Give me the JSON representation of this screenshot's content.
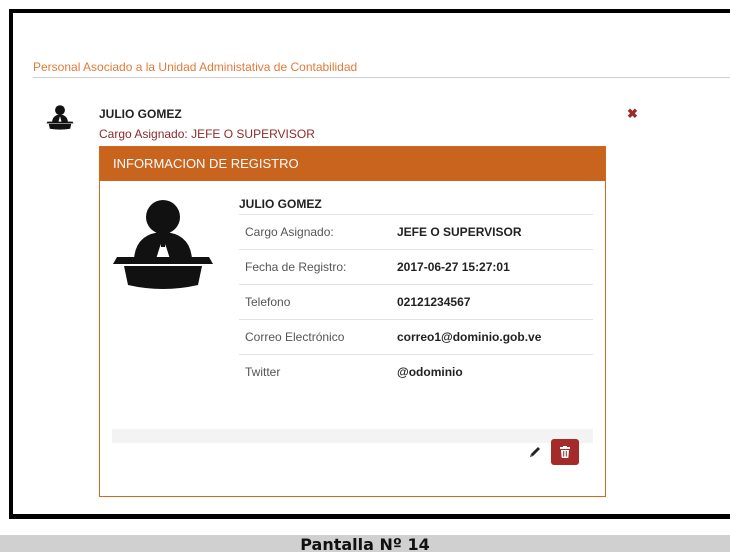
{
  "section": {
    "title": "Personal Asociado a la Unidad Administativa de Contabilidad"
  },
  "person": {
    "name": "JULIO GOMEZ",
    "role_line": "Cargo Asignado: JEFE O SUPERVISOR"
  },
  "panel": {
    "header": "INFORMACION DE REGISTRO",
    "name": "JULIO GOMEZ",
    "rows": [
      {
        "label": "Cargo Asignado:",
        "value": "JEFE O SUPERVISOR"
      },
      {
        "label": "Fecha de Registro:",
        "value": "2017-06-27 15:27:01"
      },
      {
        "label": "Telefono",
        "value": "02121234567"
      },
      {
        "label": "Correo Electrónico",
        "value": "correo1@dominio.gob.ve"
      },
      {
        "label": "Twitter",
        "value": "@odominio"
      }
    ]
  },
  "icons": {
    "remove": "close-icon",
    "edit": "pencil-icon",
    "delete": "trash-icon",
    "avatar": "person-at-desk-icon"
  },
  "colors": {
    "accent": "#c8641e",
    "danger": "#a52a2a",
    "role_text": "#8b2b2b"
  },
  "caption": "Pantalla Nº 14"
}
